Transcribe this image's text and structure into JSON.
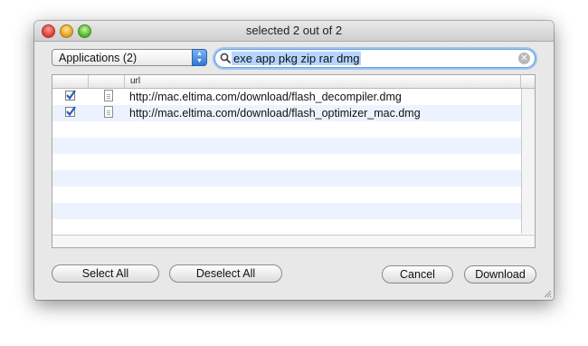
{
  "window": {
    "title": "selected 2 out of 2"
  },
  "filter": {
    "selected": "Applications (2)"
  },
  "search": {
    "value": "exe app pkg zip rar dmg"
  },
  "table": {
    "columns": [
      "",
      "",
      "url"
    ],
    "rows": [
      {
        "checked": true,
        "url": "http://mac.eltima.com/download/flash_decompiler.dmg"
      },
      {
        "checked": true,
        "url": "http://mac.eltima.com/download/flash_optimizer_mac.dmg"
      }
    ]
  },
  "buttons": {
    "select_all": "Select All",
    "deselect_all": "Deselect All",
    "cancel": "Cancel",
    "download": "Download"
  },
  "colors": {
    "stripe": "#edf3fe",
    "accent": "#3b7fd9",
    "selection": "#b5d5ff"
  },
  "icons": [
    "close-icon",
    "minimize-icon",
    "maximize-icon",
    "search-icon",
    "clear-icon",
    "checkbox-icon",
    "document-icon",
    "resize-grip-icon"
  ]
}
